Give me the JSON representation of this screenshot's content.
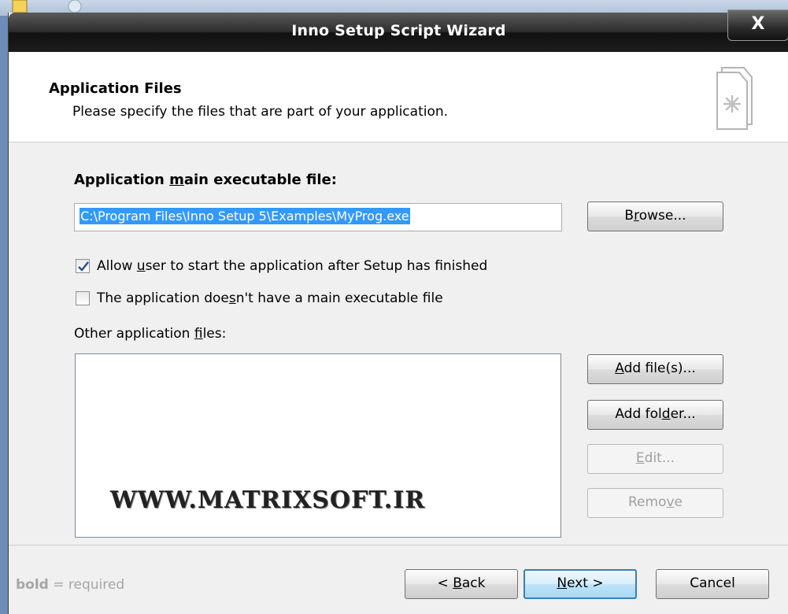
{
  "window": {
    "title": "Inno Setup Script Wizard",
    "close_label": "X"
  },
  "header": {
    "title": "Application Files",
    "subtitle": "Please specify the files that are part of your application."
  },
  "main": {
    "main_exe_label_pre": "Application ",
    "main_exe_label_u": "m",
    "main_exe_label_post": "ain executable file:",
    "main_exe_value": "C:\\Program Files\\Inno Setup 5\\Examples\\MyProg.exe",
    "browse_pre": "B",
    "browse_u": "r",
    "browse_post": "owse...",
    "allow_start": {
      "checked": true,
      "pre": "Allow ",
      "u": "u",
      "post": "ser to start the application after Setup has finished"
    },
    "no_main_exe": {
      "checked": false,
      "pre": "The application doe",
      "u": "s",
      "post": "n't have a main executable file"
    },
    "other_files_pre": "Other application ",
    "other_files_u": "f",
    "other_files_post": "iles:",
    "watermark": "WWW.MATRIXSOFT.IR",
    "add_files_u": "A",
    "add_files_post": "dd file(s)...",
    "add_folder_pre": "Add fol",
    "add_folder_u": "d",
    "add_folder_post": "er...",
    "edit_u": "E",
    "edit_post": "dit...",
    "remove_pre": "Remo",
    "remove_u": "v",
    "remove_post": "e"
  },
  "footer": {
    "note_bold": "bold",
    "note_rest": " = required",
    "back_pre": "< ",
    "back_u": "B",
    "back_post": "ack",
    "next_u": "N",
    "next_post": "ext >",
    "cancel": "Cancel"
  }
}
